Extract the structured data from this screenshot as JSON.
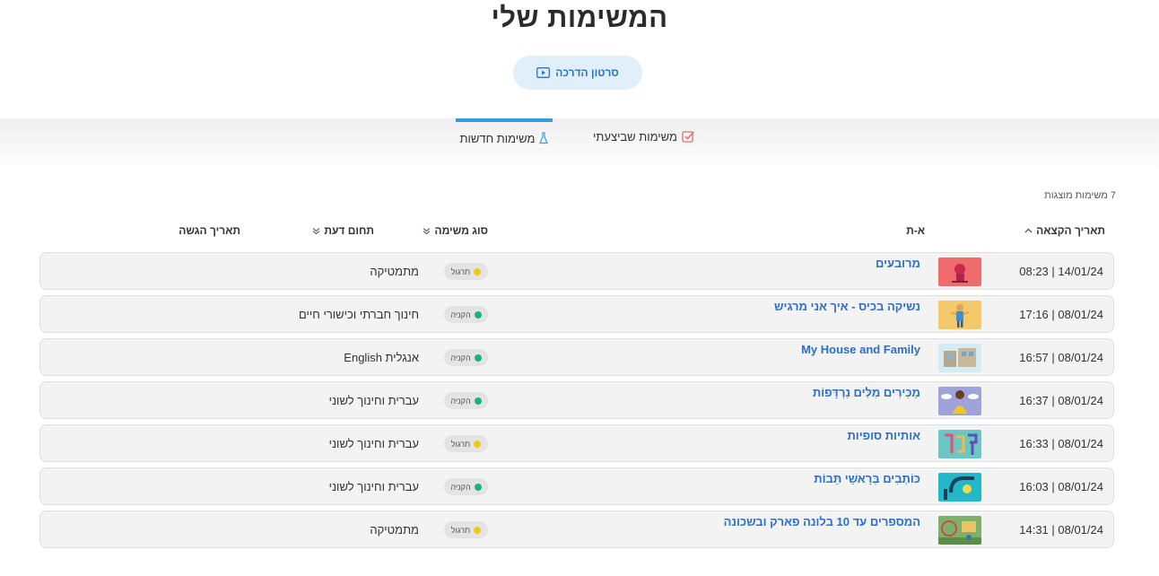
{
  "page": {
    "title": "המשימות שלי",
    "tutorial_label": "סרטון הדרכה"
  },
  "tabs": [
    {
      "label": "משימות חדשות",
      "icon": "flask-icon",
      "active": true
    },
    {
      "label": "משימות שביצעתי",
      "icon": "checkbox-icon",
      "active": false
    }
  ],
  "list": {
    "count_label": "7 משימות מוצגות",
    "headers": {
      "date": "תאריך הקצאה",
      "name": "א-ת",
      "type": "סוג משימה",
      "subject": "תחום דעת",
      "submit": "תאריך הגשה"
    },
    "rows": [
      {
        "date": "08:23 | 14/01/24",
        "name": "מרובעים",
        "type": "תרגול",
        "type_color": "#f5c518",
        "subject": "מתמטיקה",
        "thumb_color": "#f06868"
      },
      {
        "date": "17:16 | 08/01/24",
        "name": "נשיקה בכיס - איך אני מרגיש",
        "type": "הקניה",
        "type_color": "#1eb36b",
        "subject": "חינוך חברתי וכישורי חיים",
        "thumb_color": "#f4c96a"
      },
      {
        "date": "16:57 | 08/01/24",
        "name": "My House and Family",
        "type": "הקניה",
        "type_color": "#1eb36b",
        "subject": "אנגלית English",
        "thumb_color": "#cfe8f3"
      },
      {
        "date": "16:37 | 08/01/24",
        "name": "מַכִּירִים מִלִּים נִרְדָּפוֹת",
        "type": "הקניה",
        "type_color": "#1eb36b",
        "subject": "עברית וחינוך לשוני",
        "thumb_color": "#9aa0d8"
      },
      {
        "date": "16:33 | 08/01/24",
        "name": "אותיות סופיות",
        "type": "תרגול",
        "type_color": "#f5c518",
        "subject": "עברית וחינוך לשוני",
        "thumb_color": "#6fc7c7"
      },
      {
        "date": "16:03 | 08/01/24",
        "name": "כּוֹתְבִים בְּרָאשֵׁי תֵּבוֹת",
        "type": "הקניה",
        "type_color": "#1eb36b",
        "subject": "עברית וחינוך לשוני",
        "thumb_color": "#23b8c9"
      },
      {
        "date": "14:31 | 08/01/24",
        "name": "המספרים עד 10 בלונה פארק ובשכונה",
        "type": "תרגול",
        "type_color": "#f5c518",
        "subject": "מתמטיקה",
        "thumb_color": "#7fb069"
      }
    ]
  }
}
